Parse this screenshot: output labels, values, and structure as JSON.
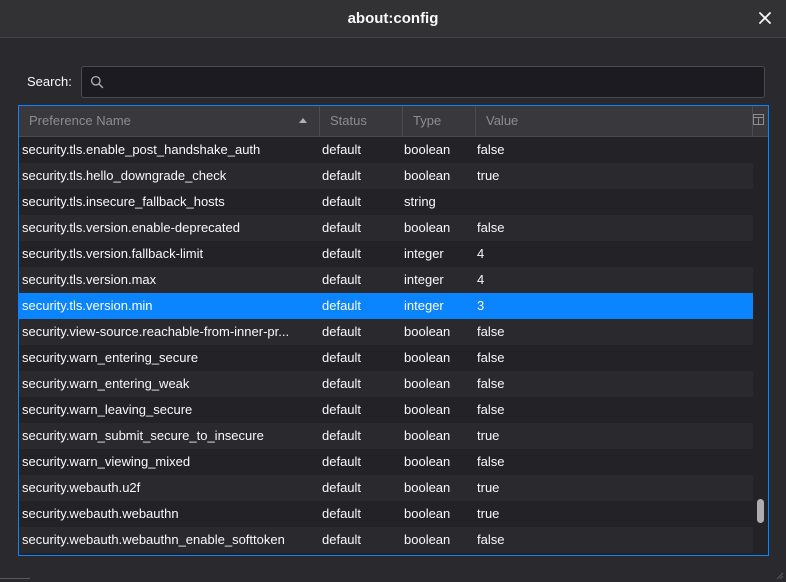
{
  "window": {
    "title": "about:config",
    "close_icon": "close-icon"
  },
  "search": {
    "label": "Search:",
    "value": "",
    "placeholder": ""
  },
  "table": {
    "columns": [
      "Preference Name",
      "Status",
      "Type",
      "Value"
    ],
    "sorted_column": "Preference Name",
    "sort_direction": "ascending",
    "selected_row": "security.tls.version.min",
    "rows": [
      {
        "name": "security.tls.enable_post_handshake_auth",
        "status": "default",
        "type": "boolean",
        "value": "false"
      },
      {
        "name": "security.tls.hello_downgrade_check",
        "status": "default",
        "type": "boolean",
        "value": "true"
      },
      {
        "name": "security.tls.insecure_fallback_hosts",
        "status": "default",
        "type": "string",
        "value": ""
      },
      {
        "name": "security.tls.version.enable-deprecated",
        "status": "default",
        "type": "boolean",
        "value": "false"
      },
      {
        "name": "security.tls.version.fallback-limit",
        "status": "default",
        "type": "integer",
        "value": "4"
      },
      {
        "name": "security.tls.version.max",
        "status": "default",
        "type": "integer",
        "value": "4"
      },
      {
        "name": "security.tls.version.min",
        "status": "default",
        "type": "integer",
        "value": "3"
      },
      {
        "name": "security.view-source.reachable-from-inner-pr...",
        "status": "default",
        "type": "boolean",
        "value": "false"
      },
      {
        "name": "security.warn_entering_secure",
        "status": "default",
        "type": "boolean",
        "value": "false"
      },
      {
        "name": "security.warn_entering_weak",
        "status": "default",
        "type": "boolean",
        "value": "false"
      },
      {
        "name": "security.warn_leaving_secure",
        "status": "default",
        "type": "boolean",
        "value": "false"
      },
      {
        "name": "security.warn_submit_secure_to_insecure",
        "status": "default",
        "type": "boolean",
        "value": "true"
      },
      {
        "name": "security.warn_viewing_mixed",
        "status": "default",
        "type": "boolean",
        "value": "false"
      },
      {
        "name": "security.webauth.u2f",
        "status": "default",
        "type": "boolean",
        "value": "true"
      },
      {
        "name": "security.webauth.webauthn",
        "status": "default",
        "type": "boolean",
        "value": "true"
      },
      {
        "name": "security.webauth.webauthn_enable_softtoken",
        "status": "default",
        "type": "boolean",
        "value": "false"
      }
    ],
    "scroll_position": 0.97
  },
  "colors": {
    "accent": "#0a84ff",
    "background": "#2a2a2e",
    "text": "#f9f9fa",
    "header_text": "#8c8c92"
  },
  "icons": {
    "search": "search-icon",
    "sort": "sort-ascending-icon",
    "column_picker": "column-picker-icon"
  }
}
